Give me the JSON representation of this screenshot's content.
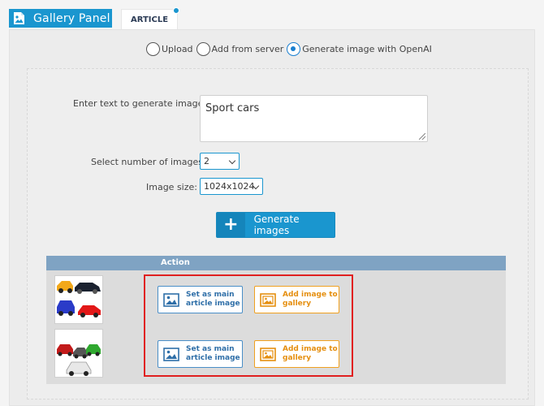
{
  "header": {
    "panel_title": "Gallery Panel",
    "panel_icon": "image-file-icon",
    "article_tab": "ARTICLE"
  },
  "source_options": {
    "items": [
      {
        "label": "Upload",
        "selected": false
      },
      {
        "label": "Add from server",
        "selected": false
      },
      {
        "label": "Generate image with OpenAI",
        "selected": true
      }
    ]
  },
  "form": {
    "prompt_label": "Enter text to generate image:",
    "prompt_value": "Sport cars",
    "count_label": "Select number of images:",
    "count_value": "2",
    "size_label": "Image size:",
    "size_value": "1024x1024",
    "generate_label": "Generate images"
  },
  "results": {
    "action_header": "Action",
    "rows": [
      {
        "thumb": "sport-cars-thumbnail-1",
        "set_main_label": "Set as main article image",
        "add_gallery_label": "Add image to gallery"
      },
      {
        "thumb": "sport-cars-thumbnail-2",
        "set_main_label": "Set as main article image",
        "add_gallery_label": "Add image to gallery"
      }
    ]
  },
  "colors": {
    "accent": "#1a96cf",
    "table_header": "#7fa3c3",
    "highlight_frame": "#e02020",
    "main_button": "#2f6fa8",
    "gallery_button": "#e58f10"
  }
}
